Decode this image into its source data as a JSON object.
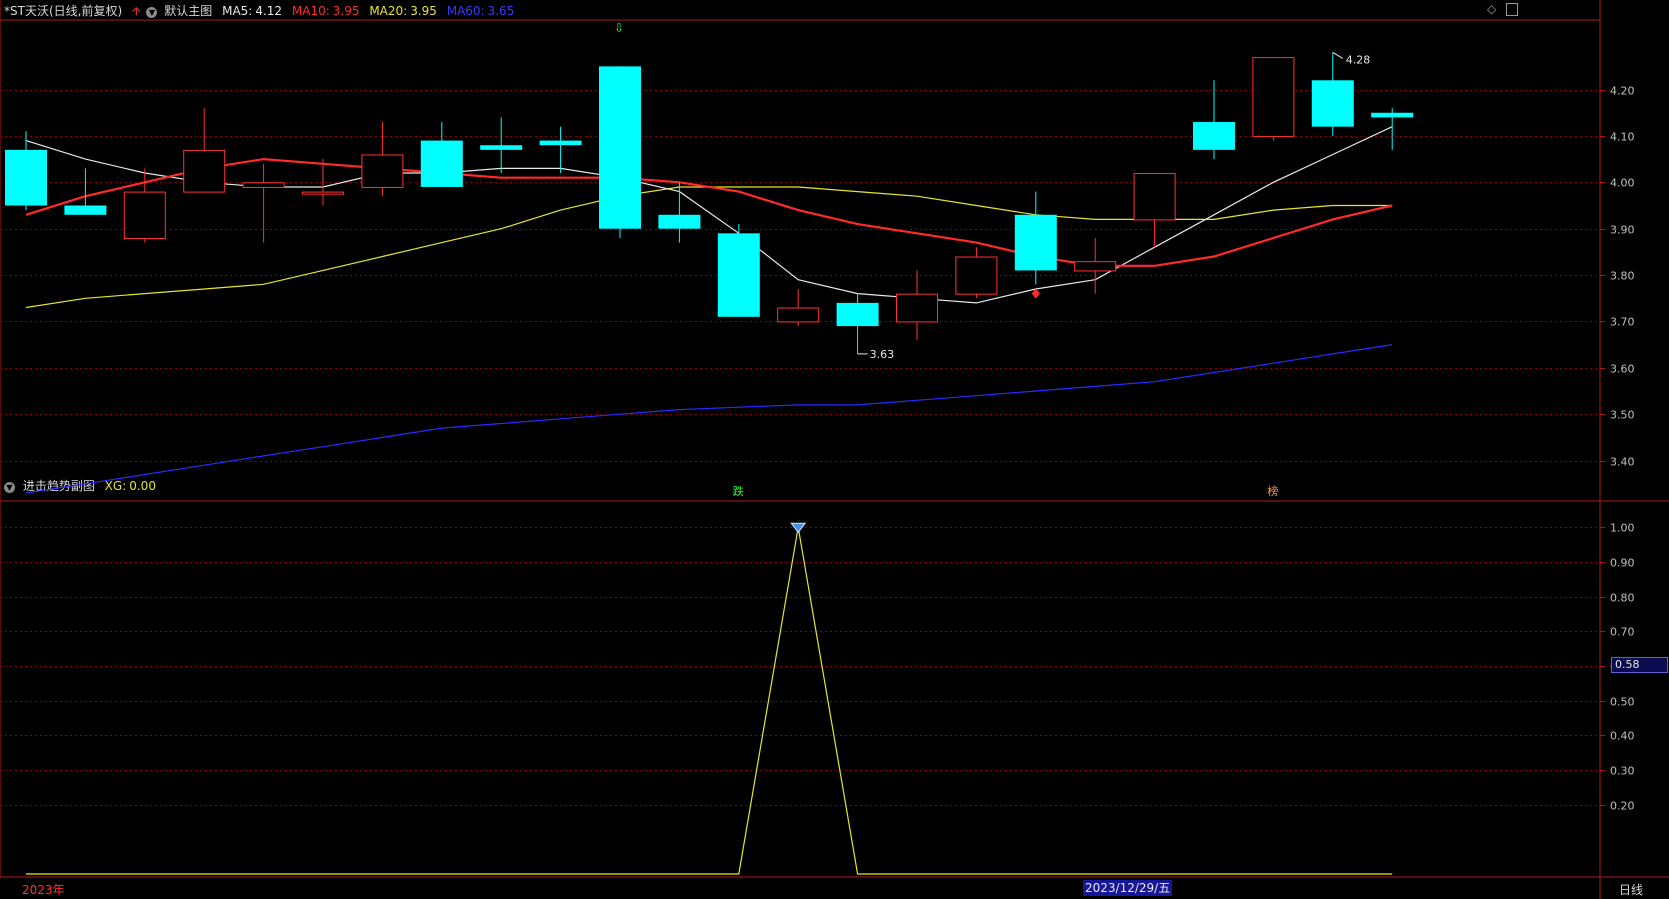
{
  "header": {
    "stock_title": "*ST天沃(日线,前复权)",
    "main_chart_name": "默认主图",
    "ma": [
      {
        "label": "MA5:",
        "value": "4.12",
        "color": "#e8e8e8"
      },
      {
        "label": "MA10:",
        "value": "3.95",
        "color": "#ff2a2a"
      },
      {
        "label": "MA20:",
        "value": "3.95",
        "color": "#e6e62a"
      },
      {
        "label": "MA60:",
        "value": "3.65",
        "color": "#2a2aff"
      }
    ]
  },
  "sub_header": {
    "indicator_name": "进击趋势副图",
    "xg_label": "XG:",
    "xg_value": "0.00"
  },
  "main_axis": {
    "ticks": [
      "4.20",
      "4.10",
      "4.00",
      "3.90",
      "3.80",
      "3.70",
      "3.60",
      "3.50",
      "3.40"
    ],
    "tick_values": [
      4.2,
      4.1,
      4.0,
      3.9,
      3.8,
      3.7,
      3.6,
      3.5,
      3.4
    ],
    "ylim": [
      3.315,
      4.35
    ]
  },
  "sub_axis": {
    "ticks": [
      "1.00",
      "0.90",
      "0.80",
      "0.70",
      "0.60",
      "0.50",
      "0.40",
      "0.30",
      "0.20"
    ],
    "tick_values": [
      1.0,
      0.9,
      0.8,
      0.7,
      0.6,
      0.5,
      0.4,
      0.3,
      0.2
    ],
    "cursor_value": "0.58",
    "ylim": [
      0.0,
      1.07
    ]
  },
  "annotations": {
    "high_label": "4.28",
    "low_label": "3.63",
    "event_die": "跌",
    "event_bang": "榜"
  },
  "footer": {
    "year_label": "2023年",
    "date_label": "2023/12/29/五",
    "period_label": "日线"
  },
  "colors": {
    "up": "#ff3232",
    "down": "#00ffff",
    "grid": "#8b0000",
    "axis_text": "#c0c0c0",
    "xg_line": "#e6e62a"
  },
  "chart_data": {
    "type": "candlestick",
    "candles": [
      {
        "o": 4.07,
        "h": 4.11,
        "l": 3.94,
        "c": 3.95
      },
      {
        "o": 3.95,
        "h": 4.03,
        "l": 3.93,
        "c": 3.93
      },
      {
        "o": 3.88,
        "h": 4.03,
        "l": 3.87,
        "c": 3.98
      },
      {
        "o": 3.98,
        "h": 4.16,
        "l": 3.98,
        "c": 4.07
      },
      {
        "o": 3.99,
        "h": 4.04,
        "l": 3.87,
        "c": 4.0
      },
      {
        "o": 3.98,
        "h": 4.05,
        "l": 3.95,
        "c": 3.98
      },
      {
        "o": 3.99,
        "h": 4.13,
        "l": 3.97,
        "c": 4.06
      },
      {
        "o": 4.09,
        "h": 4.13,
        "l": 3.99,
        "c": 3.99
      },
      {
        "o": 4.08,
        "h": 4.14,
        "l": 4.02,
        "c": 4.07
      },
      {
        "o": 4.09,
        "h": 4.12,
        "l": 4.02,
        "c": 4.08
      },
      {
        "o": 4.25,
        "h": 4.25,
        "l": 3.88,
        "c": 3.9
      },
      {
        "o": 3.93,
        "h": 4.0,
        "l": 3.87,
        "c": 3.9
      },
      {
        "o": 3.89,
        "h": 3.91,
        "l": 3.71,
        "c": 3.71
      },
      {
        "o": 3.7,
        "h": 3.77,
        "l": 3.69,
        "c": 3.73
      },
      {
        "o": 3.74,
        "h": 3.76,
        "l": 3.63,
        "c": 3.69
      },
      {
        "o": 3.7,
        "h": 3.81,
        "l": 3.66,
        "c": 3.76
      },
      {
        "o": 3.76,
        "h": 3.86,
        "l": 3.75,
        "c": 3.84
      },
      {
        "o": 3.93,
        "h": 3.98,
        "l": 3.78,
        "c": 3.81
      },
      {
        "o": 3.81,
        "h": 3.88,
        "l": 3.76,
        "c": 3.83
      },
      {
        "o": 3.92,
        "h": 4.02,
        "l": 3.86,
        "c": 4.02
      },
      {
        "o": 4.13,
        "h": 4.22,
        "l": 4.05,
        "c": 4.07
      },
      {
        "o": 4.1,
        "h": 4.27,
        "l": 4.09,
        "c": 4.27
      },
      {
        "o": 4.22,
        "h": 4.28,
        "l": 4.1,
        "c": 4.12
      },
      {
        "o": 4.15,
        "h": 4.16,
        "l": 4.07,
        "c": 4.14
      }
    ],
    "ma5": [
      4.09,
      4.05,
      4.02,
      4.0,
      3.99,
      3.99,
      4.02,
      4.02,
      4.03,
      4.03,
      4.01,
      3.98,
      3.89,
      3.79,
      3.76,
      3.75,
      3.74,
      3.77,
      3.79,
      3.86,
      3.93,
      4.0,
      4.06,
      4.12
    ],
    "ma10": [
      3.93,
      3.97,
      4.0,
      4.03,
      4.05,
      4.04,
      4.03,
      4.02,
      4.01,
      4.01,
      4.01,
      4.0,
      3.98,
      3.94,
      3.91,
      3.89,
      3.87,
      3.84,
      3.82,
      3.82,
      3.84,
      3.88,
      3.92,
      3.95
    ],
    "ma20": [
      3.73,
      3.75,
      3.76,
      3.77,
      3.78,
      3.81,
      3.84,
      3.87,
      3.9,
      3.94,
      3.97,
      3.99,
      3.99,
      3.99,
      3.98,
      3.97,
      3.95,
      3.93,
      3.92,
      3.92,
      3.92,
      3.94,
      3.95,
      3.95
    ],
    "ma60": [
      3.33,
      3.35,
      3.37,
      3.39,
      3.41,
      3.43,
      3.45,
      3.47,
      3.48,
      3.49,
      3.5,
      3.51,
      3.515,
      3.52,
      3.52,
      3.53,
      3.54,
      3.55,
      3.56,
      3.57,
      3.59,
      3.61,
      3.63,
      3.65
    ],
    "xg_series": [
      0,
      0,
      0,
      0,
      0,
      0,
      0,
      0,
      0,
      0,
      0,
      0,
      0,
      1,
      0,
      0,
      0,
      0,
      0,
      0,
      0,
      0,
      0,
      0
    ]
  }
}
